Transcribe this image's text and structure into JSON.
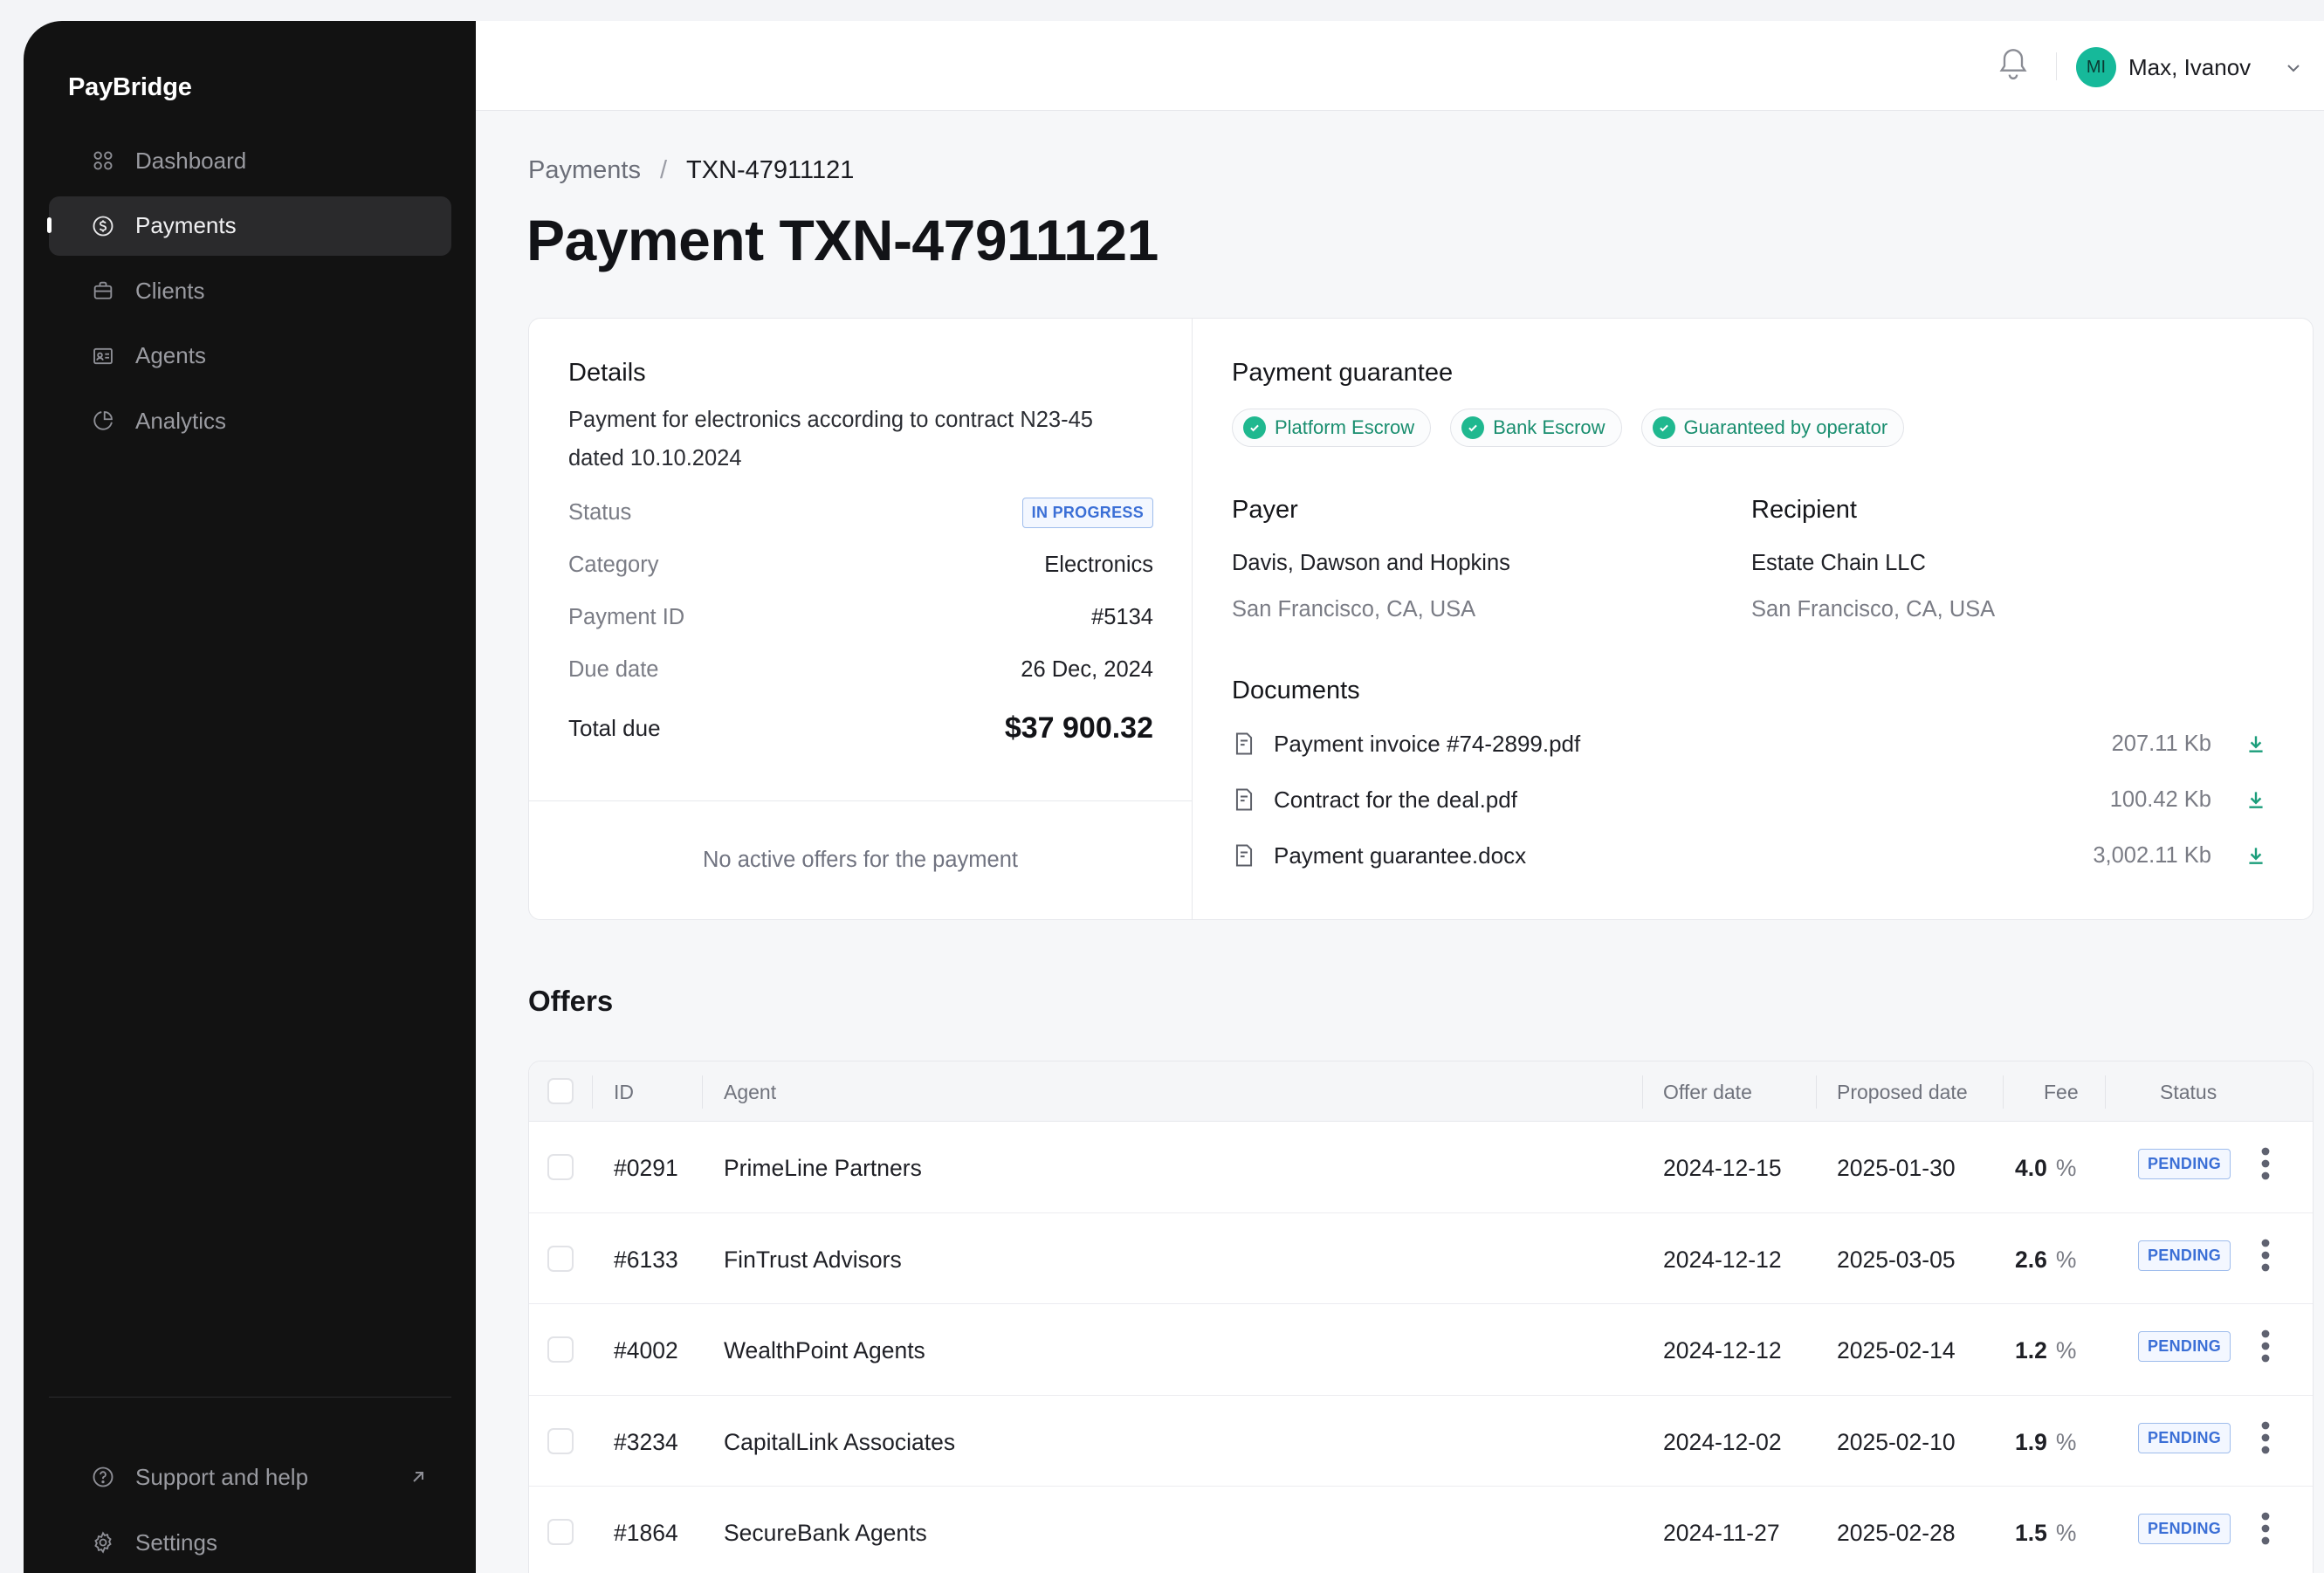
{
  "app": {
    "name": "PayBridge"
  },
  "sidebar": {
    "items": [
      {
        "label": "Dashboard",
        "icon": "grid-icon"
      },
      {
        "label": "Payments",
        "icon": "dollar-circle-icon",
        "active": true
      },
      {
        "label": "Clients",
        "icon": "briefcase-icon"
      },
      {
        "label": "Agents",
        "icon": "id-card-icon"
      },
      {
        "label": "Analytics",
        "icon": "pie-chart-icon"
      }
    ],
    "bottom": [
      {
        "label": "Support and help",
        "icon": "help-circle-icon"
      },
      {
        "label": "Settings",
        "icon": "gear-icon"
      }
    ]
  },
  "topbar": {
    "user_initials": "MI",
    "user_name": "Max, Ivanov"
  },
  "breadcrumb": {
    "parent": "Payments",
    "separator": "/",
    "current": "TXN-47911121"
  },
  "page_title": "Payment TXN-47911121",
  "details": {
    "title": "Details",
    "description": "Payment for electronics according to contract N23-45 dated 10.10.2024",
    "status_label": "Status",
    "status_value": "IN PROGRESS",
    "category_label": "Category",
    "category_value": "Electronics",
    "payment_id_label": "Payment ID",
    "payment_id_value": "#5134",
    "due_date_label": "Due date",
    "due_date_value": "26 Dec, 2024",
    "total_label": "Total due",
    "total_value": "$37 900.32",
    "no_offers": "No active offers for the payment"
  },
  "guarantee": {
    "title": "Payment guarantee",
    "chips": [
      "Platform Escrow",
      "Bank Escrow",
      "Guaranteed by operator"
    ],
    "payer_label": "Payer",
    "payer_name": "Davis, Dawson and Hopkins",
    "payer_location": "San Francisco, CA, USA",
    "recipient_label": "Recipient",
    "recipient_name": "Estate Chain LLC",
    "recipient_location": "San Francisco, CA, USA",
    "documents_title": "Documents",
    "documents": [
      {
        "name": "Payment invoice #74-2899.pdf",
        "size": "207.11 Kb"
      },
      {
        "name": "Contract for the deal.pdf",
        "size": "100.42 Kb"
      },
      {
        "name": "Payment guarantee.docx",
        "size": "3,002.11 Kb"
      }
    ]
  },
  "offers": {
    "title": "Offers",
    "columns": {
      "id": "ID",
      "agent": "Agent",
      "offer_date": "Offer date",
      "proposed_date": "Proposed date",
      "fee": "Fee",
      "status": "Status"
    },
    "rows": [
      {
        "id": "#0291",
        "agent": "PrimeLine Partners",
        "offer_date": "2024-12-15",
        "proposed_date": "2025-01-30",
        "fee": "4.0",
        "fee_unit": "%",
        "status": "PENDING"
      },
      {
        "id": "#6133",
        "agent": "FinTrust Advisors",
        "offer_date": "2024-12-12",
        "proposed_date": "2025-03-05",
        "fee": "2.6",
        "fee_unit": "%",
        "status": "PENDING"
      },
      {
        "id": "#4002",
        "agent": "WealthPoint Agents",
        "offer_date": "2024-12-12",
        "proposed_date": "2025-02-14",
        "fee": "1.2",
        "fee_unit": "%",
        "status": "PENDING"
      },
      {
        "id": "#3234",
        "agent": "CapitalLink Associates",
        "offer_date": "2024-12-02",
        "proposed_date": "2025-02-10",
        "fee": "1.9",
        "fee_unit": "%",
        "status": "PENDING"
      },
      {
        "id": "#1864",
        "agent": "SecureBank Agents",
        "offer_date": "2024-11-27",
        "proposed_date": "2025-02-28",
        "fee": "1.5",
        "fee_unit": "%",
        "status": "PENDING"
      }
    ]
  },
  "colors": {
    "sidebar_bg": "#121212",
    "accent_green": "#1fb88f",
    "badge_blue": "#3b6fd6",
    "avatar_bg": "#16b99a"
  }
}
